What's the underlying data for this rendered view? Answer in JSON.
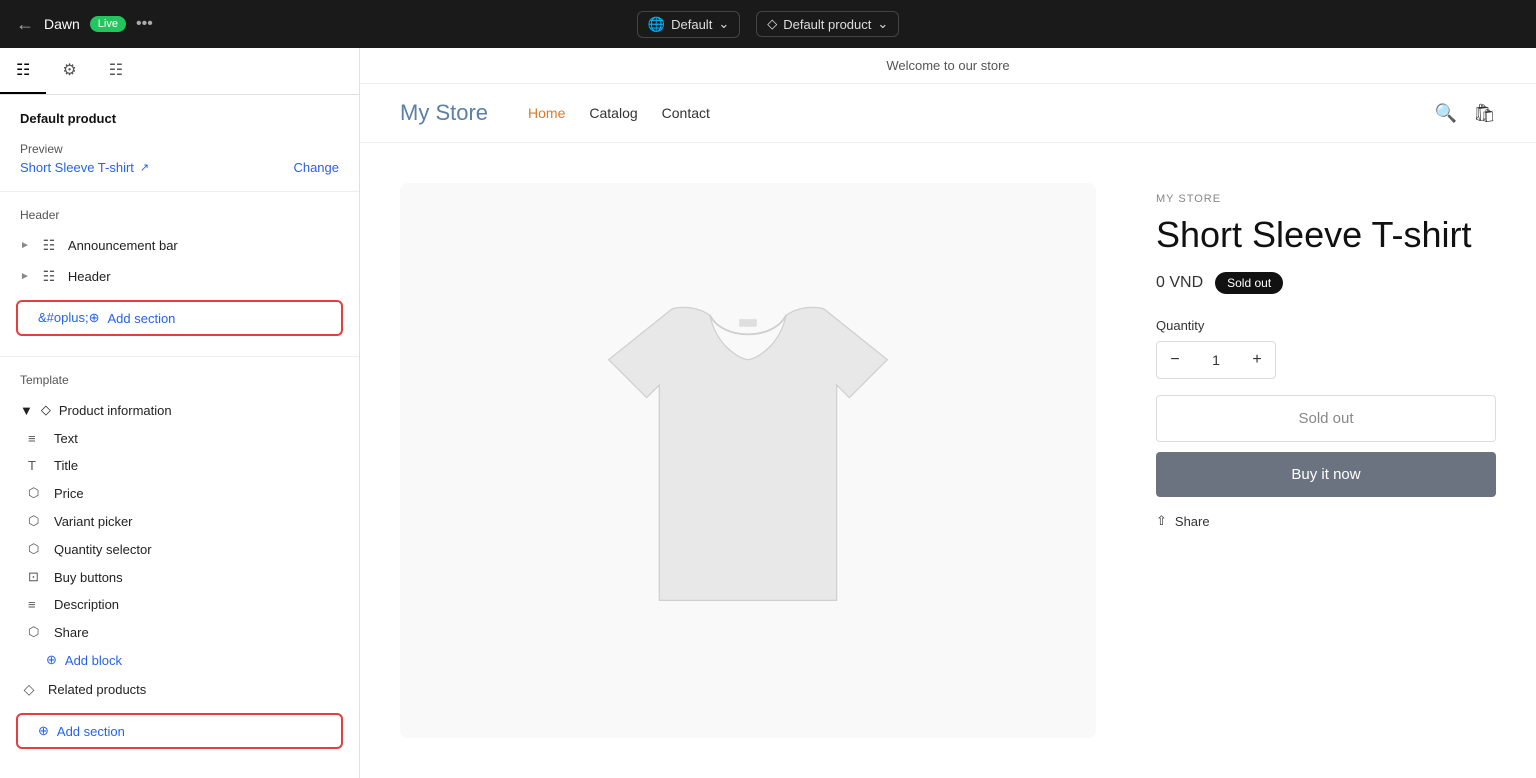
{
  "topbar": {
    "back_icon": "←",
    "store_name": "Dawn",
    "live_label": "Live",
    "more_icon": "•••",
    "default_dropdown": "Default",
    "product_dropdown": "Default product"
  },
  "sidebar": {
    "title": "Default product",
    "preview_label": "Preview",
    "preview_value": "Short Sleeve T-shirt",
    "change_label": "Change",
    "header_section_title": "Header",
    "announcement_bar_label": "Announcement bar",
    "header_label": "Header",
    "add_section_label": "Add section",
    "template_section_title": "Template",
    "product_info_label": "Product information",
    "items": [
      {
        "label": "Text",
        "icon": "≡"
      },
      {
        "label": "Title",
        "icon": "T"
      },
      {
        "label": "Price",
        "icon": "⬜"
      },
      {
        "label": "Variant picker",
        "icon": "⬜"
      },
      {
        "label": "Quantity selector",
        "icon": "⬜"
      },
      {
        "label": "Buy buttons",
        "icon": "⊡"
      },
      {
        "label": "Description",
        "icon": "≡"
      },
      {
        "label": "Share",
        "icon": "⬜"
      }
    ],
    "add_block_label": "Add block",
    "related_products_label": "Related products",
    "add_section_bottom_label": "Add section"
  },
  "preview": {
    "announcement_text": "Welcome to our store",
    "store_name": "My Store",
    "nav_links": [
      {
        "label": "Home",
        "active": true
      },
      {
        "label": "Catalog"
      },
      {
        "label": "Contact"
      }
    ],
    "product": {
      "brand": "MY STORE",
      "title": "Short Sleeve T-shirt",
      "price": "0 VND",
      "sold_out_badge": "Sold out",
      "quantity_label": "Quantity",
      "quantity_value": "1",
      "sold_out_btn_label": "Sold out",
      "buy_now_label": "Buy it now",
      "share_label": "Share",
      "qty_minus": "−",
      "qty_plus": "+"
    }
  }
}
